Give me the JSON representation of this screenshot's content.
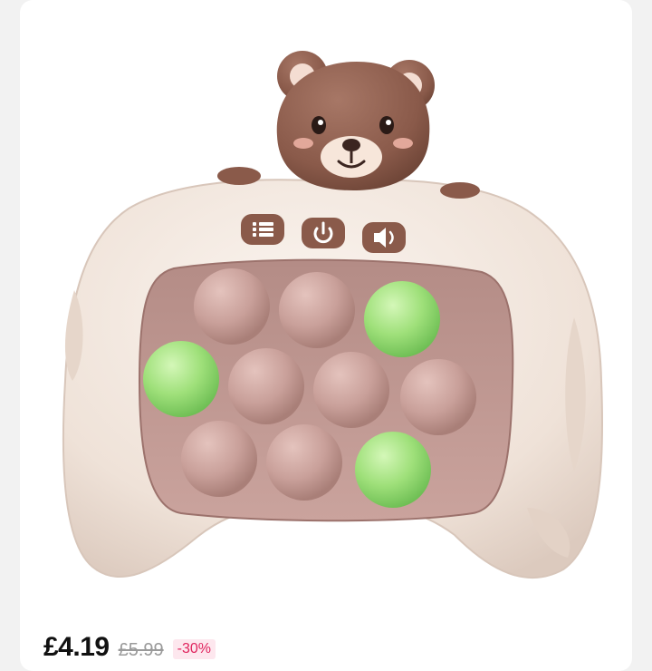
{
  "product": {
    "image_alt_name": "bear-quick-push-game-console",
    "icons": [
      "menu-icon",
      "power-icon",
      "speaker-icon"
    ],
    "bubble_colors": {
      "pink": "#c9a09a",
      "green": "#9fe07a"
    }
  },
  "pricing": {
    "current_price": "£4.19",
    "original_price": "£5.99",
    "discount": "-30%"
  },
  "colors": {
    "body": "#f1e6dc",
    "bear": "#8a5a4a",
    "discount": "#e0245e"
  }
}
